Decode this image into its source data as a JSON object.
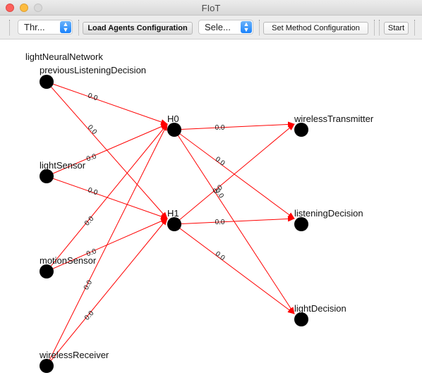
{
  "window": {
    "title": "FIoT"
  },
  "toolbar": {
    "combo1_value": "Thr...",
    "load_agents_label": "Load Agents Configuration",
    "combo2_value": "Sele...",
    "set_method_label": "Set Method Configuration",
    "start_label": "Start"
  },
  "network": {
    "name": "lightNeuralNetwork",
    "inputs": [
      "previousListeningDecision",
      "lightSensor",
      "motionSensor",
      "wirelessReceiver"
    ],
    "hidden": [
      "H0",
      "H1"
    ],
    "outputs": [
      "wirelessTransmitter",
      "listeningDecision",
      "lightDecision"
    ],
    "weight_label": "0.0",
    "edge_color": "#ff0000",
    "node_color": "#000000"
  }
}
